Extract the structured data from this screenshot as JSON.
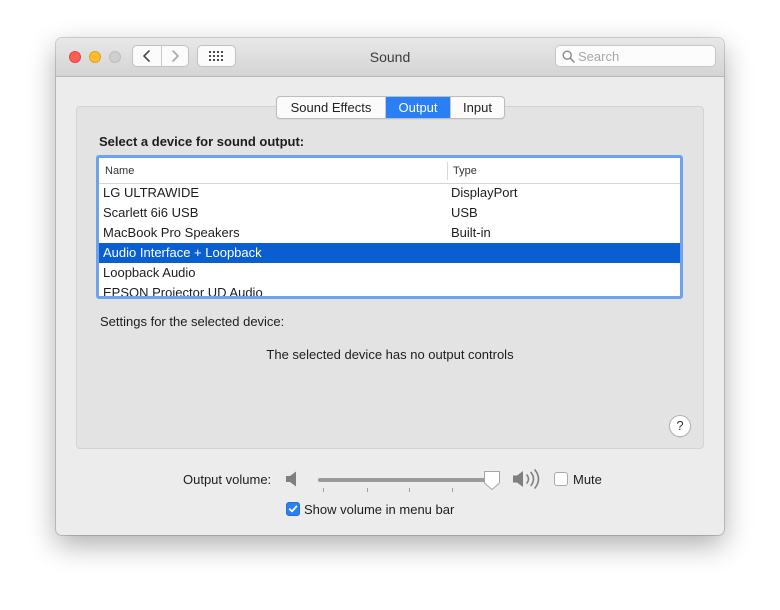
{
  "window": {
    "title": "Sound"
  },
  "toolbar": {
    "search_placeholder": "Search"
  },
  "tabs": [
    {
      "label": "Sound Effects",
      "selected": false
    },
    {
      "label": "Output",
      "selected": true
    },
    {
      "label": "Input",
      "selected": false
    }
  ],
  "output": {
    "select_label": "Select a device for sound output:",
    "columns": {
      "name": "Name",
      "type": "Type"
    },
    "devices": [
      {
        "name": "LG ULTRAWIDE",
        "type": "DisplayPort"
      },
      {
        "name": "Scarlett 6i6 USB",
        "type": "USB"
      },
      {
        "name": "MacBook Pro Speakers",
        "type": "Built-in"
      },
      {
        "name": "Audio Interface + Loopback",
        "type": "",
        "selected": true
      },
      {
        "name": "Loopback Audio",
        "type": ""
      },
      {
        "name": "EPSON Projector UD Audio",
        "type": ""
      }
    ],
    "settings_label": "Settings for the selected device:",
    "no_controls_message": "The selected device has no output controls",
    "help_label": "?"
  },
  "volume": {
    "label": "Output volume:",
    "level": 0.98,
    "mute_label": "Mute",
    "mute_checked": false,
    "show_in_menu_bar_label": "Show volume in menu bar",
    "show_in_menu_bar_checked": true
  },
  "colors": {
    "accent": "#2a7ff5",
    "selection": "#0a5fd0",
    "focus_ring": "#6da3ee",
    "close": "#fd5f57",
    "minimize": "#febc2e"
  }
}
